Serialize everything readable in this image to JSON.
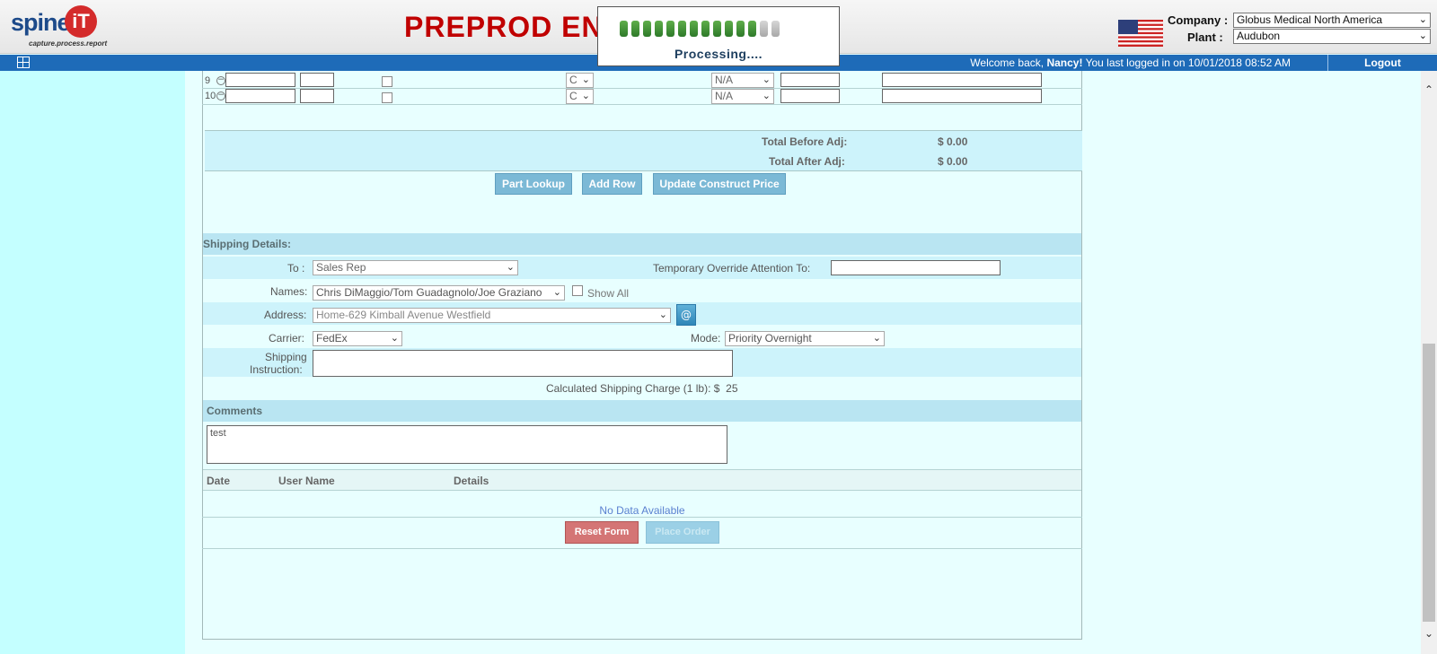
{
  "header": {
    "logo_text": "spine",
    "logo_letter": "iT",
    "logo_tagline": "capture.process.report",
    "title": "PREPROD EN",
    "company_label": "Company :",
    "company_value": "Globus Medical North America",
    "plant_label": "Plant :",
    "plant_value": "Audubon",
    "flag_icon": "us-flag-icon"
  },
  "processing": {
    "text": "Processing....",
    "bars_total": 14,
    "bars_active": 12
  },
  "navbar": {
    "welcome_prefix": "Welcome back, ",
    "welcome_user": "Nancy!",
    "welcome_suffix": " You last logged in on 10/01/2018 08:52 AM",
    "logout_label": "Logout"
  },
  "parts": {
    "rows": [
      {
        "line": "9",
        "set_value": "C",
        "status_value": "N/A"
      },
      {
        "line": "10",
        "set_value": "C",
        "status_value": "N/A"
      }
    ],
    "total_before_label": "Total Before Adj:",
    "total_before_value": "$ 0.00",
    "total_after_label": "Total After Adj:",
    "total_after_value": "$ 0.00",
    "buttons": {
      "part_lookup": "Part Lookup",
      "add_row": "Add Row",
      "update_price": "Update Construct Price"
    }
  },
  "shipping": {
    "header": "Shipping Details:",
    "to_label": "To :",
    "to_value": "Sales Rep",
    "override_label": "Temporary Override Attention To:",
    "override_value": "",
    "names_label": "Names:",
    "names_value": "Chris DiMaggio/Tom Guadagnolo/Joe Graziano",
    "show_all_label": "Show All",
    "address_label": "Address:",
    "address_value": "Home-629 Kimball Avenue Westfield",
    "address_button": "@",
    "carrier_label": "Carrier:",
    "carrier_value": "FedEx",
    "mode_label": "Mode:",
    "mode_value": "Priority Overnight",
    "instruction_label_1": "Shipping",
    "instruction_label_2": "Instruction:",
    "instruction_value": "",
    "charge_label": "Calculated Shipping Charge (1 lb):",
    "charge_currency": "$",
    "charge_value": "25"
  },
  "comments": {
    "header": "Comments",
    "value": "test",
    "history_columns": [
      "Date",
      "User Name",
      "Details"
    ],
    "no_data": "No Data Available"
  },
  "actions": {
    "reset": "Reset Form",
    "place": "Place Order"
  },
  "colors": {
    "accent": "#1e6bb8",
    "title_red": "#c00000",
    "reset_red": "#d47575",
    "button_blue": "#7bb9d6"
  }
}
